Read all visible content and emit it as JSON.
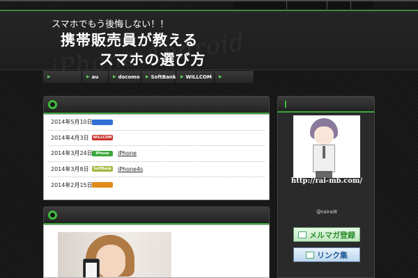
{
  "top_nav": {
    "items": [
      {
        "label": ""
      },
      {
        "label": ""
      },
      {
        "label": ""
      },
      {
        "label": ""
      }
    ]
  },
  "header": {
    "tagline": "スマホでもう後悔しない！！",
    "title_line1": "携帯販売員が教える",
    "title_line2": "スマホの選び方",
    "watermark": "iPhone Android",
    "description": [
      "",
      "",
      "",
      "",
      "",
      ""
    ]
  },
  "main_nav": {
    "items": [
      {
        "label": ""
      },
      {
        "label": "au"
      },
      {
        "label": "docomo"
      },
      {
        "label": "SoftBank"
      },
      {
        "label": "WILLCOM"
      },
      {
        "label": ""
      }
    ]
  },
  "breadcrumb": "",
  "news": {
    "title": "",
    "items": [
      {
        "date": "2014年5月10日",
        "carrier": "",
        "badge_color": "#2f6fd6",
        "title": ""
      },
      {
        "date": "2014年4月3日",
        "carrier": "WILLCOM",
        "badge_color": "#c8332b",
        "title": ""
      },
      {
        "date": "2014年3月24日",
        "carrier": "iPhone",
        "badge_color": "#3aa83a",
        "title": "iPhone"
      },
      {
        "date": "2014年3月8日",
        "carrier": "SoftBank",
        "badge_color": "#a0b83a",
        "title": "iPhone4s"
      },
      {
        "date": "2014年2月15日",
        "carrier": "",
        "badge_color": "#e08a1a",
        "title": ""
      }
    ]
  },
  "article": {
    "title": ""
  },
  "sidebar": {
    "profile_title": "",
    "url": "http://rai-mb.com/",
    "line1": "",
    "line2": "",
    "line3": "@rairai8",
    "banner1": "メルマガ登録",
    "banner2": "リンク集"
  },
  "colors": {
    "accent": "#3fbf3f",
    "background": "#181818"
  }
}
